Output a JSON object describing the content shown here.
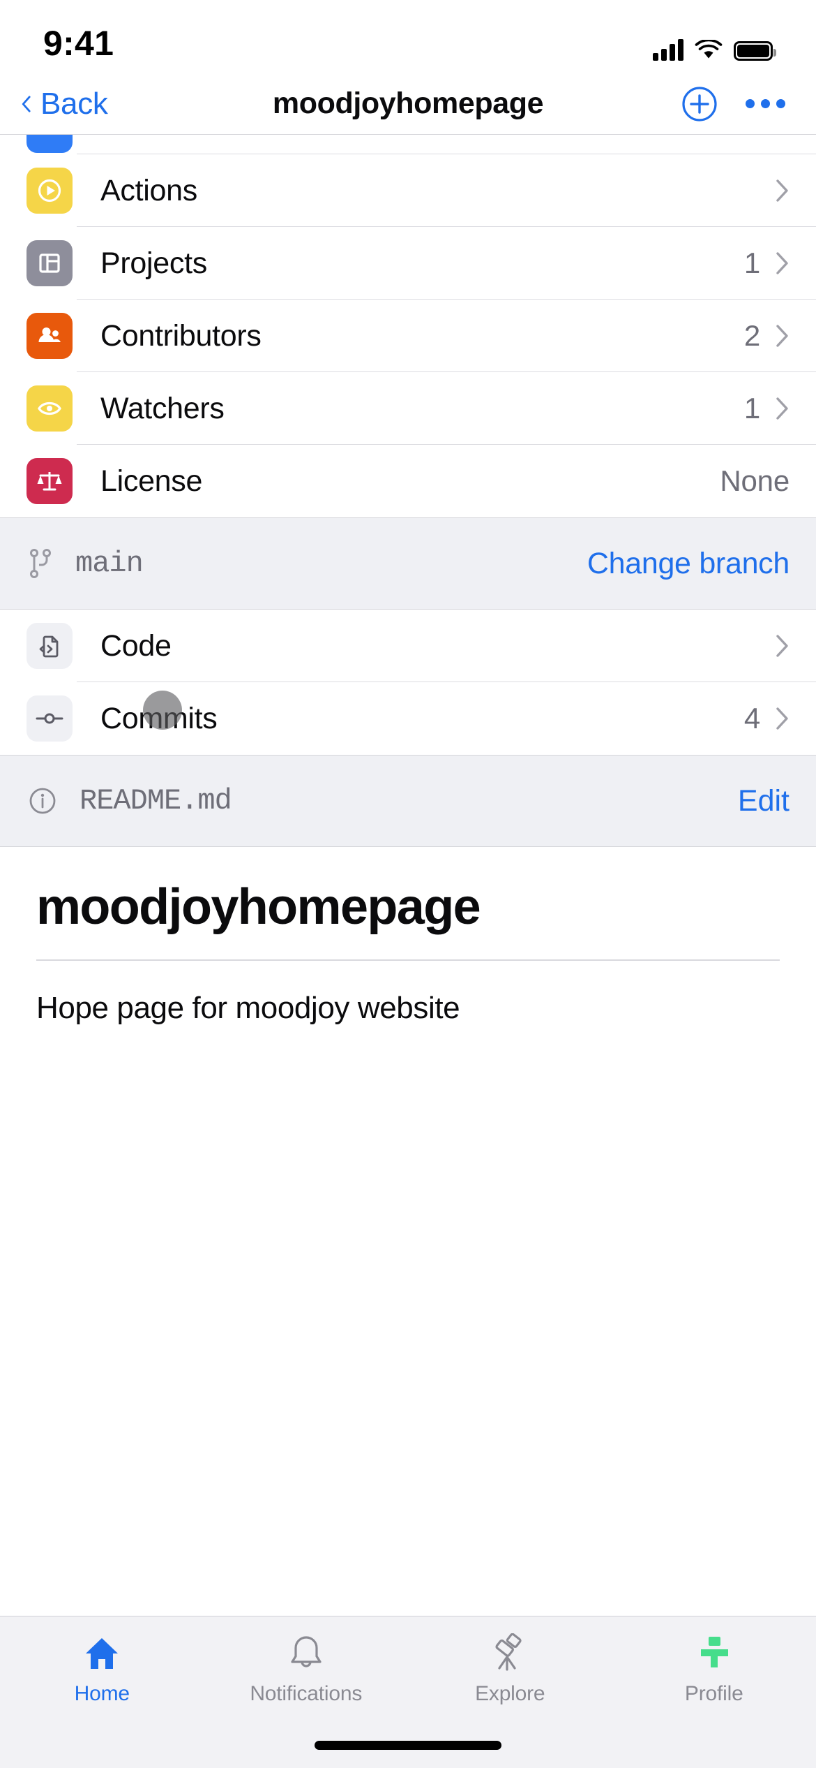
{
  "status_bar": {
    "time": "9:41"
  },
  "nav": {
    "back_label": "Back",
    "title": "moodjoyhomepage",
    "add_icon": "plus-circle-icon",
    "more_icon": "ellipsis-icon"
  },
  "repo_rows": [
    {
      "label": "Actions",
      "value": "",
      "icon": "play-circle-icon",
      "icon_color": "#F5D548",
      "chevron": true
    },
    {
      "label": "Projects",
      "value": "1",
      "icon": "table-layout-icon",
      "icon_color": "#8E8E9B",
      "chevron": true
    },
    {
      "label": "Contributors",
      "value": "2",
      "icon": "people-icon",
      "icon_color": "#E8590C",
      "chevron": true
    },
    {
      "label": "Watchers",
      "value": "1",
      "icon": "eye-icon",
      "icon_color": "#F5D548",
      "chevron": true
    },
    {
      "label": "License",
      "value": "None",
      "icon": "scales-icon",
      "icon_color": "#CE2B4F",
      "chevron": false
    }
  ],
  "branch": {
    "icon": "git-branch-icon",
    "name": "main",
    "action_label": "Change branch"
  },
  "code_rows": [
    {
      "label": "Code",
      "value": "",
      "icon": "file-code-icon",
      "chevron": true
    },
    {
      "label": "Commits",
      "value": "4",
      "icon": "git-commit-icon",
      "chevron": true
    }
  ],
  "readme_bar": {
    "icon": "info-circle-icon",
    "filename": "README.md",
    "edit_label": "Edit"
  },
  "readme": {
    "heading": "moodjoyhomepage",
    "paragraph": "Hope page for moodjoy website"
  },
  "tabs": [
    {
      "label": "Home",
      "icon": "home-icon",
      "active": true
    },
    {
      "label": "Notifications",
      "icon": "bell-icon",
      "active": false
    },
    {
      "label": "Explore",
      "icon": "telescope-icon",
      "active": false
    },
    {
      "label": "Profile",
      "icon": "avatar-icon",
      "active": false
    }
  ],
  "colors": {
    "accent_blue": "#1f6feb",
    "profile_green": "#46dd8b",
    "section_bg": "#eff0f4"
  }
}
